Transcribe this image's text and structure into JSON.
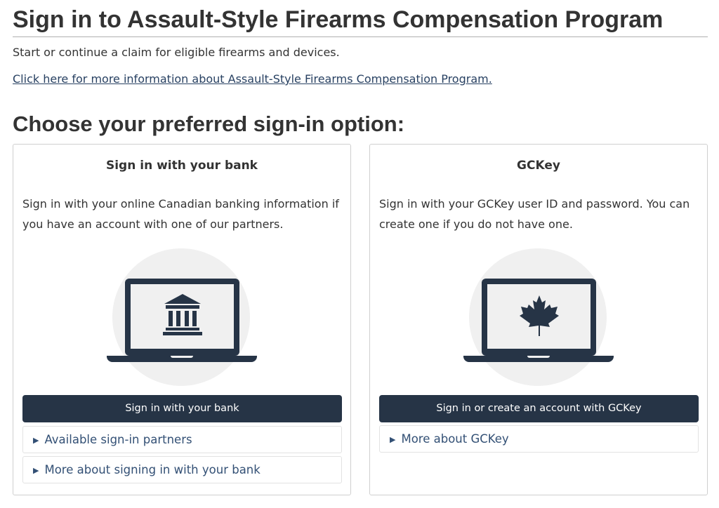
{
  "page": {
    "title": "Sign in to Assault-Style Firearms Compensation Program",
    "intro": "Start or continue a claim for eligible firearms and devices.",
    "info_link": "Click here for more information about Assault-Style Firearms Compensation Program.",
    "section_heading": "Choose your preferred sign-in option:"
  },
  "cards": {
    "bank": {
      "title": "Sign in with your bank",
      "description": "Sign in with your online Canadian banking information if you have an account with one of our partners.",
      "illustration_icon": "bank-building-icon",
      "button_label": "Sign in with your bank",
      "details": [
        {
          "label": "Available sign-in partners"
        },
        {
          "label": "More about signing in with your bank"
        }
      ]
    },
    "gckey": {
      "title": "GCKey",
      "description": "Sign in with your GCKey user ID and password. You can create one if you do not have one.",
      "illustration_icon": "maple-leaf-icon",
      "button_label": "Sign in or create an account with GCKey",
      "details": [
        {
          "label": "More about GCKey"
        }
      ]
    }
  },
  "colors": {
    "primary_button": "#263446",
    "link": "#284162",
    "text": "#333333",
    "illustration_bg": "#f0f0f0"
  }
}
